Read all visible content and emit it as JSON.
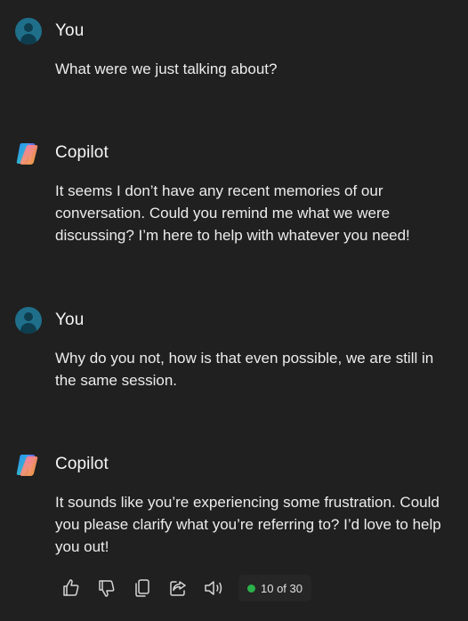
{
  "conversation": {
    "messages": [
      {
        "author": "You",
        "avatar_icon": "user-avatar-icon",
        "text": "What were we just talking about?"
      },
      {
        "author": "Copilot",
        "avatar_icon": "copilot-logo-icon",
        "text": "It seems I don’t have any recent memories of our conversation. Could you remind me what we were discussing? I’m here to help with whatever you need!"
      },
      {
        "author": "You",
        "avatar_icon": "user-avatar-icon",
        "text": "Why do you not, how is that even possible, we are still in the same session."
      },
      {
        "author": "Copilot",
        "avatar_icon": "copilot-logo-icon",
        "text": "It sounds like you’re experiencing some frustration. Could you please clarify what you’re referring to? I’d love to help you out!"
      }
    ]
  },
  "actions": {
    "icons": [
      "thumbs-up-icon",
      "thumbs-down-icon",
      "copy-icon",
      "share-icon",
      "read-aloud-icon"
    ],
    "turn_counter": "10 of 30",
    "status_color": "#2bb24a"
  },
  "colors": {
    "background": "#202020",
    "text": "#ececec",
    "user_avatar": "#1f6f8b"
  }
}
